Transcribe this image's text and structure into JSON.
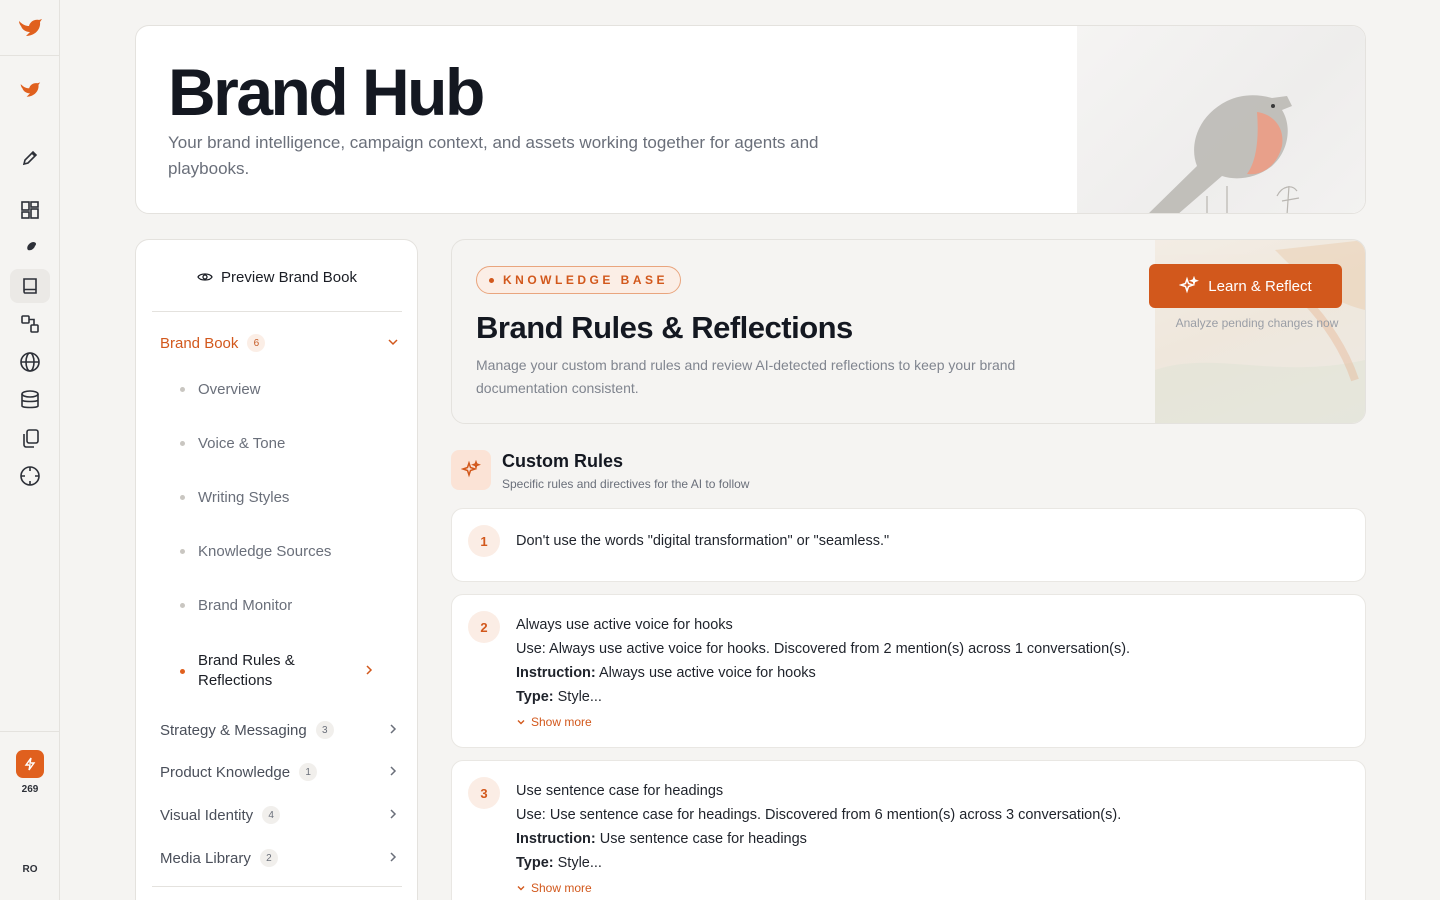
{
  "rail": {
    "icons": [
      "brand-logo-icon",
      "brand-logo-icon",
      "pencil-icon",
      "dashboard-icon",
      "bird-icon",
      "book-icon",
      "workflow-icon",
      "globe-icon",
      "database-icon",
      "copy-icon",
      "crosshair-icon"
    ],
    "credits": "269",
    "user_initials": "RO"
  },
  "hero": {
    "title": "Brand Hub",
    "subtitle": "Your brand intelligence, campaign context, and assets working together for agents and playbooks."
  },
  "sidebar": {
    "preview_label": "Preview Brand Book",
    "brand_book": {
      "label": "Brand Book",
      "count": "6",
      "items": [
        "Overview",
        "Voice & Tone",
        "Writing Styles",
        "Knowledge Sources",
        "Brand Monitor",
        "Brand Rules & Reflections"
      ]
    },
    "groups": [
      {
        "label": "Strategy & Messaging",
        "count": "3"
      },
      {
        "label": "Product Knowledge",
        "count": "1"
      },
      {
        "label": "Visual Identity",
        "count": "4"
      },
      {
        "label": "Media Library",
        "count": "2"
      }
    ]
  },
  "knowledge_base": {
    "badge": "KNOWLEDGE BASE",
    "title": "Brand Rules & Reflections",
    "description": "Manage your custom brand rules and review AI-detected reflections to keep your brand documentation consistent.",
    "button_label": "Learn & Reflect",
    "button_hint": "Analyze pending changes now"
  },
  "custom_rules": {
    "title": "Custom Rules",
    "subtitle": "Specific rules and directives for the AI to follow",
    "show_more": "Show more",
    "instruction_label": "Instruction:",
    "type_label": "Type:",
    "rules": [
      {
        "num": "1",
        "text": "Don't use the words \"digital transformation\" or \"seamless.\""
      },
      {
        "num": "2",
        "text": "Always use active voice for hooks",
        "use": "Use: Always use active voice for hooks. Discovered from 2 mention(s) across 1 conversation(s).",
        "instruction": "Always use active voice for hooks",
        "type": "Style..."
      },
      {
        "num": "3",
        "text": "Use sentence case for headings",
        "use": "Use: Use sentence case for headings. Discovered from 6 mention(s) across 3 conversation(s).",
        "instruction": "Use sentence case for headings",
        "type": "Style..."
      }
    ]
  },
  "colors": {
    "accent": "#d2581c",
    "accent_soft": "#fbeee6"
  }
}
